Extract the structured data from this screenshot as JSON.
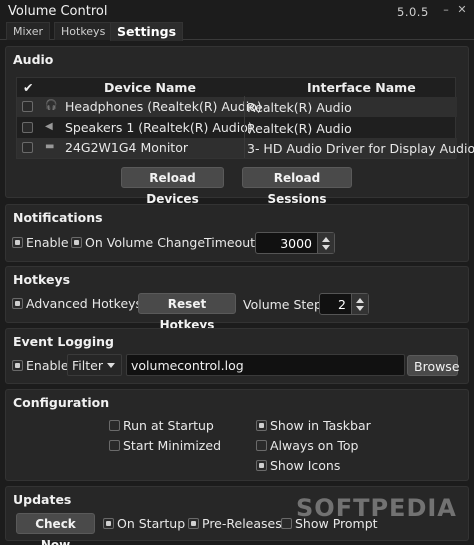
{
  "window": {
    "title": "Volume Control",
    "version": "5.0.5"
  },
  "tabs": [
    "Mixer",
    "Hotkeys",
    "Settings"
  ],
  "audio": {
    "title": "Audio",
    "header_check": "✔",
    "col_device": "Device Name",
    "col_interface": "Interface Name",
    "devices": [
      {
        "name": "Headphones (Realtek(R) Audio)",
        "interface": "Realtek(R) Audio",
        "checked": false,
        "icon": "headphones-icon"
      },
      {
        "name": "Speakers 1 (Realtek(R) Audio)",
        "interface": "Realtek(R) Audio",
        "checked": false,
        "icon": "speaker-icon"
      },
      {
        "name": "24G2W1G4 Monitor",
        "interface": "3- HD Audio Driver for Display Audio",
        "checked": false,
        "icon": "monitor-icon"
      }
    ],
    "reload_devices": "Reload Devices",
    "reload_sessions": "Reload Sessions"
  },
  "notifications": {
    "title": "Notifications",
    "enable": "Enable",
    "on_volume_change": "On Volume Change",
    "timeout_label": "Timeout",
    "timeout_value": "3000"
  },
  "hotkeys": {
    "title": "Hotkeys",
    "advanced": "Advanced Hotkeys",
    "reset": "Reset Hotkeys",
    "step_label": "Volume Step",
    "step_value": "2"
  },
  "logging": {
    "title": "Event Logging",
    "enable": "Enable",
    "filter": "Filter",
    "file": "volumecontrol.log",
    "browse": "Browse"
  },
  "configuration": {
    "title": "Configuration",
    "run_at_startup": "Run at Startup",
    "start_minimized": "Start Minimized",
    "show_in_taskbar": "Show in Taskbar",
    "always_on_top": "Always on Top",
    "show_icons": "Show Icons"
  },
  "updates": {
    "title": "Updates",
    "check_now": "Check Now",
    "on_startup": "On Startup",
    "pre_releases": "Pre-Releases",
    "show_prompt": "Show Prompt"
  },
  "watermark": "SOFTPEDIA"
}
